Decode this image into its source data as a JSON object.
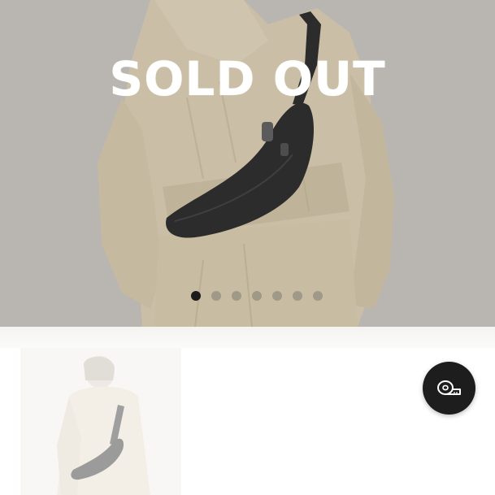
{
  "hero": {
    "status_label": "SOLD OUT",
    "carousel": {
      "total_slides": 7,
      "active_index": 0
    }
  },
  "thumbnail": {
    "icon": "product-thumbnail"
  },
  "size_guide": {
    "icon": "measuring-tape-icon"
  },
  "colors": {
    "dot_active": "#1c1c1c",
    "fab_background": "#1d1d1d",
    "coat": "#ddd0b2",
    "bag": "#1b1b1b"
  }
}
